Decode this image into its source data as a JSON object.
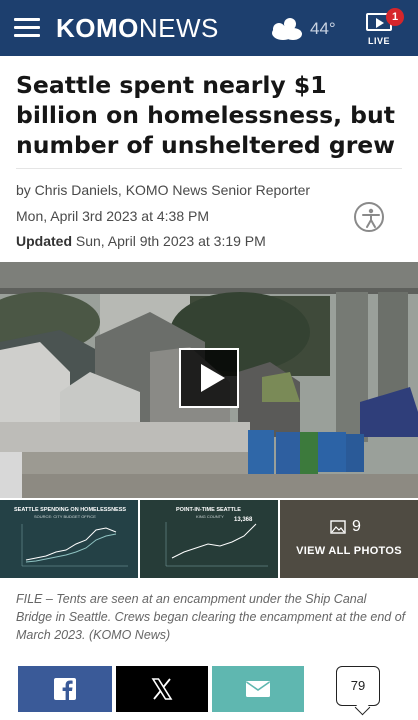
{
  "header": {
    "logo_bold": "KOMO",
    "logo_light": "NEWS",
    "temperature": "44°",
    "live_label": "LIVE",
    "live_badge_count": "1",
    "weather_icon": "partly-cloudy-icon"
  },
  "article": {
    "headline": "Seattle spent nearly $1 billion on homelessness, but number of unsheltered grew",
    "byline": "by Chris Daniels, KOMO News Senior Reporter",
    "published": "Mon, April 3rd 2023 at 4:38 PM",
    "updated_label": "Updated",
    "updated": "Sun, April 9th 2023 at 3:19 PM"
  },
  "gallery": {
    "thumb1_title": "SEATTLE SPENDING ON HOMELESSNESS",
    "thumb1_sub": "SOURCE: CITY BUDGET OFFICE",
    "thumb2_title": "POINT-IN-TIME SEATTLE",
    "thumb2_sub": "KING COUNTY",
    "thumb2_big": "13,368",
    "photo_count": "9",
    "view_all": "VIEW ALL PHOTOS"
  },
  "caption": "FILE – Tents are seen at an encampment under the Ship Canal Bridge in Seattle. Crews began clearing the encampment at the end of March 2023. (KOMO News)",
  "share": {
    "facebook_icon": "facebook-icon",
    "x_icon": "x-icon",
    "email_icon": "email-icon",
    "comment_count": "79"
  }
}
